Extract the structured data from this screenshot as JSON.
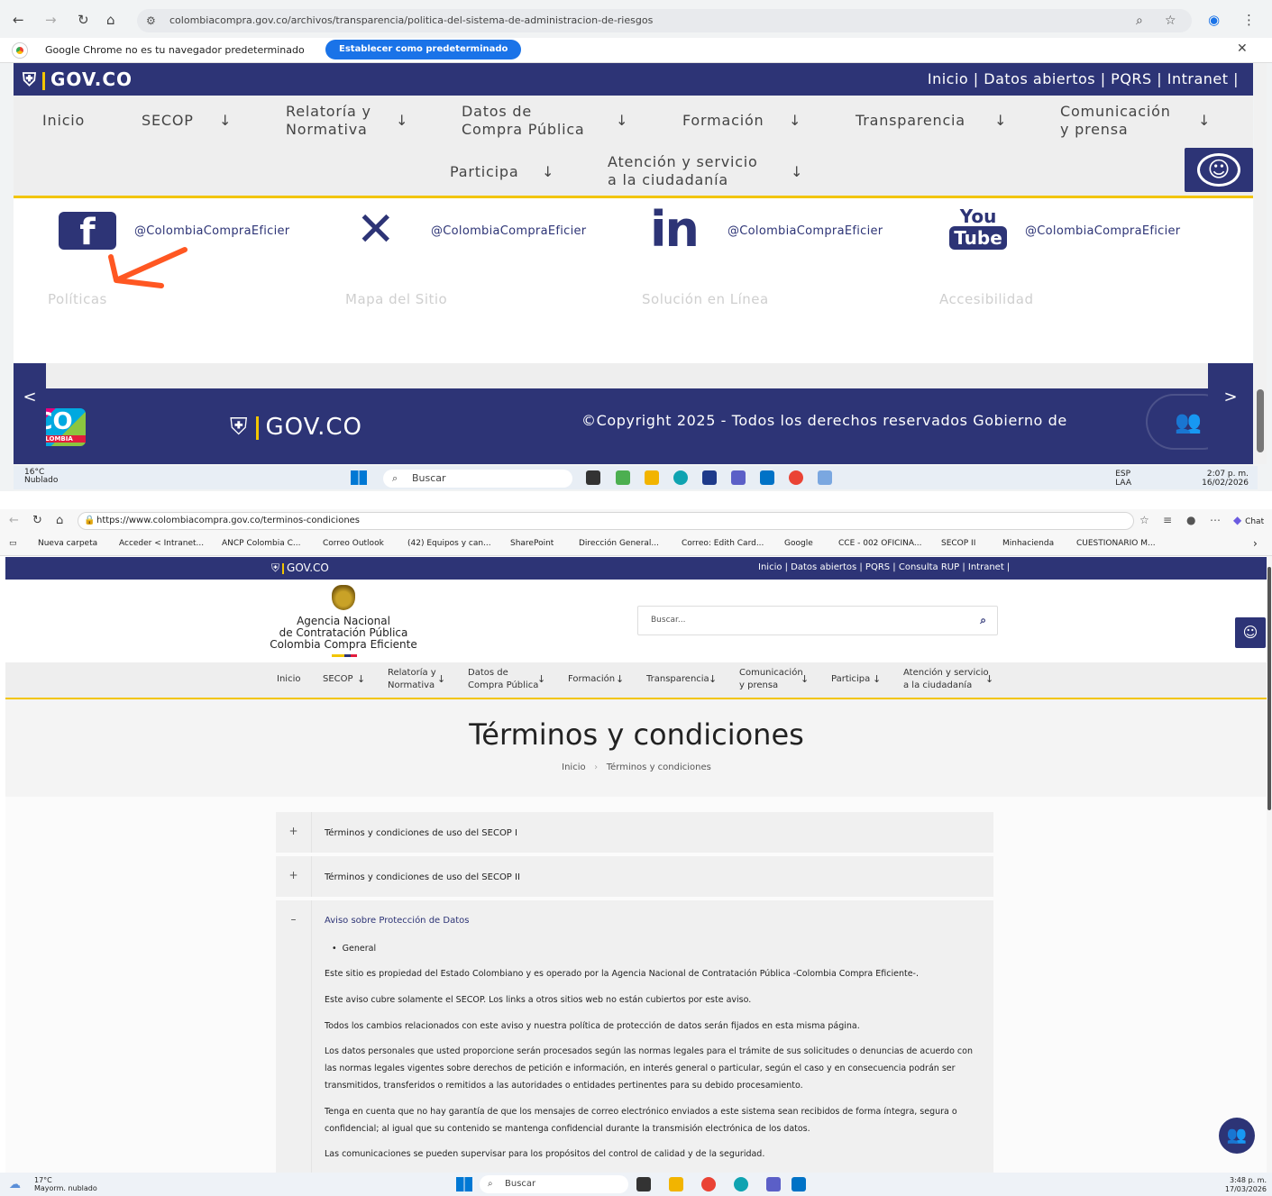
{
  "top": {
    "browser": {
      "url": "colombiacompra.gov.co/archivos/transparencia/politica-del-sistema-de-administracion-de-riesgos",
      "infobar_message": "Google Chrome no es tu navegador predeterminado",
      "infobar_button": "Establecer como predeterminado"
    },
    "gov_logo": "GOV.CO",
    "gov_links": "Inicio |  Datos abiertos |  PQRS |  Intranet |",
    "menu": {
      "inicio": "Inicio",
      "secop": "SECOP",
      "relatoria_1": "Relatoría y",
      "relatoria_2": "Normativa",
      "datos_1": "Datos de",
      "datos_2": "Compra Pública",
      "formacion": "Formación",
      "transparencia": "Transparencia",
      "comunicacion_1": "Comunicación",
      "comunicacion_2": "y prensa",
      "participa": "Participa",
      "atencion_1": "Atención y servicio",
      "atencion_2": "a la ciudadanía",
      "arrow": "↓"
    },
    "social": {
      "facebook": "@ColombiaCompraEficier",
      "x": "@ColombiaCompraEficier",
      "linkedin": "@ColombiaCompraEficier",
      "youtube": "@ColombiaCompraEficier",
      "youtube_you": "You",
      "youtube_tube": "Tube"
    },
    "footer_links": {
      "politicas": "Políticas",
      "mapa": "Mapa del Sitio",
      "solucion": "Solución en Línea",
      "accesibilidad": "Accesibilidad"
    },
    "copyright": "©Copyright 2025 - Todos los derechos reservados Gobierno de",
    "colombia_badge": "CO",
    "colombia_badge_small": "COLOMBIA",
    "taskbar": {
      "weather_temp": "16°C",
      "weather_desc": "Nublado",
      "search": "Buscar",
      "lang_1": "ESP",
      "lang_2": "LAA",
      "time": "2:07 p. m.",
      "date": "16/02/2026"
    }
  },
  "bottom": {
    "browser": {
      "url": "https://www.colombiacompra.gov.co/terminos-condiciones",
      "chat": "Chat"
    },
    "bookmarks": [
      "Nueva carpeta",
      "Acceder < Intranet...",
      "ANCP Colombia C...",
      "Correo Outlook",
      "(42) Equipos y can...",
      "SharePoint",
      "Dirección General...",
      "Correo: Edith Card...",
      "Google",
      "CCE - 002 OFICINA...",
      "SECOP II",
      "Minhacienda",
      "CUESTIONARIO M..."
    ],
    "gov_logo": "GOV.CO",
    "gov_links": "Inicio |  Datos abiertos |  PQRS |  Consulta RUP |  Intranet |",
    "agency": {
      "line1": "Agencia Nacional",
      "line2": "de Contratación Pública",
      "line3": "Colombia Compra Eficiente"
    },
    "search_placeholder": "Buscar...",
    "menu": {
      "inicio": "Inicio",
      "secop": "SECOP",
      "relatoria_1": "Relatoría y",
      "relatoria_2": "Normativa",
      "datos_1": "Datos de",
      "datos_2": "Compra Pública",
      "formacion": "Formación",
      "transparencia": "Transparencia",
      "comunicacion_1": "Comunicación",
      "comunicacion_2": "y prensa",
      "participa": "Participa",
      "atencion_1": "Atención y servicio",
      "atencion_2": "a la ciudadanía",
      "arrow": "↓"
    },
    "title": "Términos y condiciones",
    "breadcrumb": {
      "home": "Inicio",
      "sep": "›",
      "current": "Términos y condiciones"
    },
    "accordion": {
      "item1": "Términos y condiciones de uso del SECOP I",
      "item2": "Términos y condiciones de uso del SECOP II",
      "item3": "Aviso sobre Protección de Datos",
      "plus": "+",
      "minus": "–",
      "bullet": "General",
      "paragraphs": [
        "Este sitio es propiedad del Estado Colombiano y es operado por la Agencia Nacional de Contratación Pública -Colombia Compra Eficiente-.",
        "Este aviso cubre solamente el SECOP. Los links a otros sitios web no están cubiertos por este aviso.",
        "Todos los cambios relacionados con este aviso y nuestra política de protección de datos serán fijados en esta misma página.",
        "Los datos personales que usted proporcione serán procesados según las normas legales para el trámite de sus solicitudes o denuncias de acuerdo con las normas legales vigentes sobre derechos de petición e información, en interés general o particular, según el caso y en consecuencia podrán ser transmitidos, transferidos o remitidos a las autoridades o entidades pertinentes para su debido procesamiento.",
        "Tenga en cuenta que no hay garantía de que los mensajes de correo electrónico enviados a este sistema sean recibidos de forma íntegra, segura o confidencial; al igual que su contenido se mantenga confidencial durante la transmisión electrónica de los datos.",
        "Las comunicaciones se pueden supervisar para los propósitos del control de calidad y de la seguridad."
      ]
    },
    "taskbar": {
      "weather_temp": "17°C",
      "weather_desc": "Mayorm. nublado",
      "search": "Buscar",
      "time": "3:48 p. m.",
      "date": "17/03/2026"
    }
  },
  "colors": {
    "navy": "#2d3476",
    "gold": "#f2c500",
    "arrow": "#ff5722"
  }
}
